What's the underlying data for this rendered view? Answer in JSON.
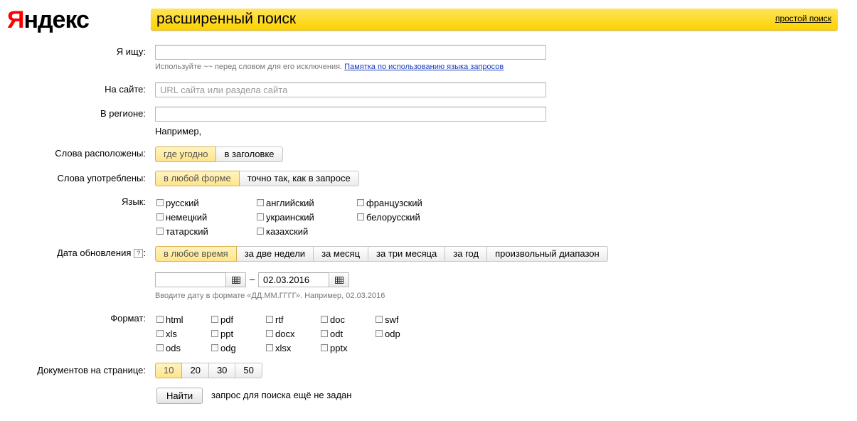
{
  "logo": {
    "first_letter": "Я",
    "rest": "ндекс"
  },
  "header": {
    "title": "расширенный поиск",
    "simple_search_link": "простой поиск"
  },
  "query": {
    "label": "Я ищу:",
    "value": "",
    "hint": "Используйте ~~ перед словом для его исключения.",
    "hint_link": "Памятка по использованию языка запросов"
  },
  "site": {
    "label": "На сайте:",
    "placeholder": "URL сайта или раздела сайта",
    "value": ""
  },
  "region": {
    "label": "В регионе:",
    "value": "",
    "example": "Например,"
  },
  "words_position": {
    "label": "Слова расположены:",
    "options": [
      "где угодно",
      "в заголовке"
    ],
    "selected": 0
  },
  "words_form": {
    "label": "Слова употреблены:",
    "options": [
      "в любой форме",
      "точно так, как в запросе"
    ],
    "selected": 0
  },
  "language": {
    "label": "Язык:",
    "options": [
      "русский",
      "немецкий",
      "татарский",
      "английский",
      "украинский",
      "казахский",
      "французский",
      "белорусский"
    ]
  },
  "date": {
    "label": "Дата обновления",
    "help": "?",
    "options": [
      "в любое время",
      "за две недели",
      "за месяц",
      "за три месяца",
      "за год",
      "произвольный диапазон"
    ],
    "selected": 0,
    "from_value": "",
    "separator": "–",
    "to_value": "02.03.2016",
    "hint": "Вводите дату в формате «ДД.ММ.ГГГГ». Например, 02.03.2016"
  },
  "format": {
    "label": "Формат:",
    "options": [
      "html",
      "xls",
      "ods",
      "pdf",
      "ppt",
      "odg",
      "rtf",
      "docx",
      "xlsx",
      "doc",
      "odt",
      "pptx",
      "swf",
      "odp"
    ]
  },
  "per_page": {
    "label": "Документов на странице:",
    "options": [
      "10",
      "20",
      "30",
      "50"
    ],
    "selected": 0
  },
  "find": {
    "button_label": "Найти",
    "status": "запрос для поиска ещё не задан"
  }
}
